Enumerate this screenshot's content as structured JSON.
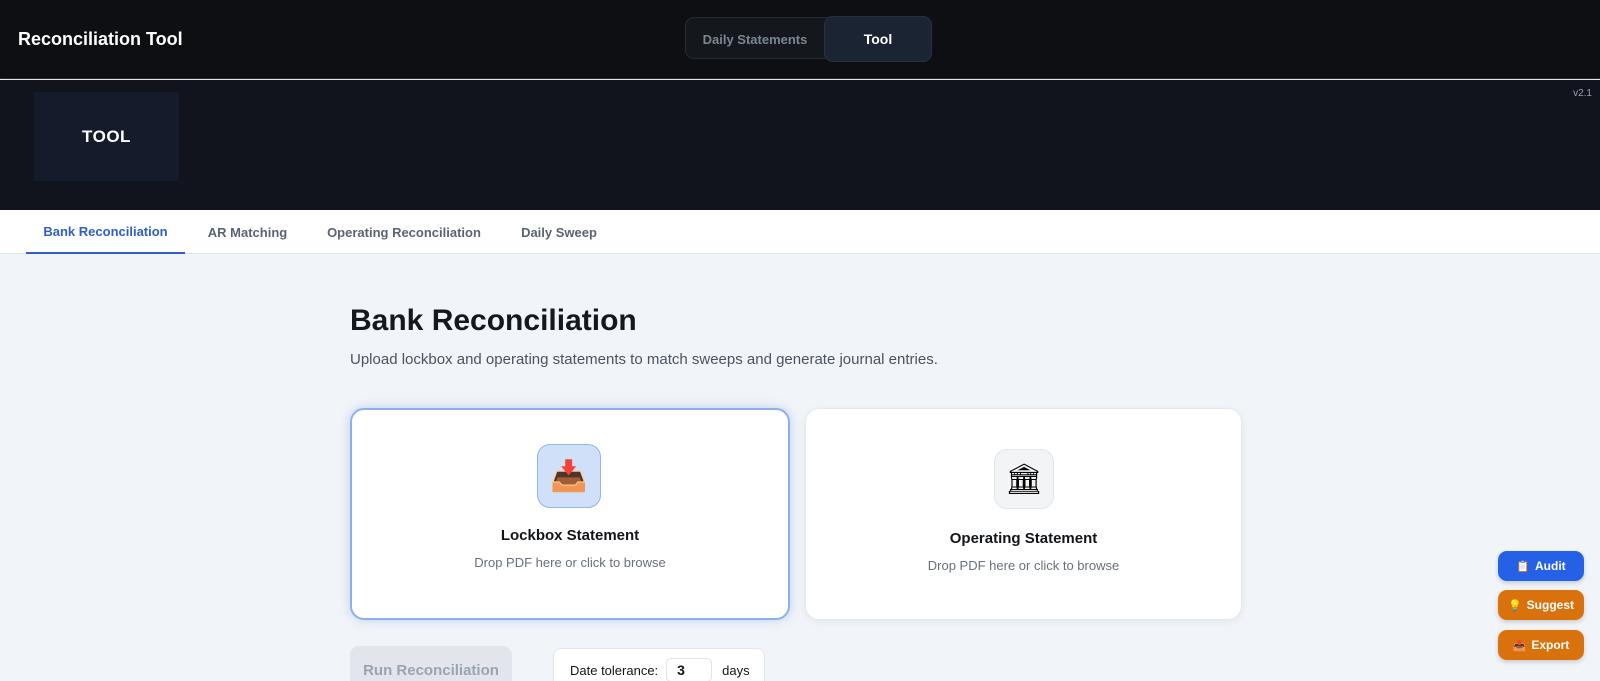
{
  "app": {
    "title": "Reconciliation Tool",
    "version": "v2.1"
  },
  "mode_switch": {
    "daily_label": "Daily Statements",
    "tool_label": "Tool",
    "selected": "Tool"
  },
  "banner": {
    "label": "TOOL"
  },
  "tabs": [
    {
      "label": "Bank Reconciliation",
      "active": true
    },
    {
      "label": "AR Matching",
      "active": false
    },
    {
      "label": "Operating Reconciliation",
      "active": false
    },
    {
      "label": "Daily Sweep",
      "active": false
    }
  ],
  "main": {
    "title": "Bank Reconciliation",
    "subtitle": "Upload lockbox and operating statements to match sweeps and generate journal entries.",
    "cards": [
      {
        "title": "Lockbox Statement",
        "hint": "Drop PDF here or click to browse",
        "icon": "inbox-tray-icon",
        "selected": true
      },
      {
        "title": "Operating Statement",
        "hint": "Drop PDF here or click to browse",
        "icon": "bank-icon",
        "selected": false
      }
    ],
    "run_label": "Run Reconciliation",
    "tolerance": {
      "label": "Date tolerance:",
      "value": "3",
      "unit": "days"
    }
  },
  "floating": {
    "audit_label": "Audit",
    "suggest_label": "Suggest",
    "export_label": "Export"
  },
  "colors": {
    "accent": "#2f5fc4",
    "audit": "#2561e6",
    "suggest": "#d9720c",
    "export": "#d9720c"
  }
}
